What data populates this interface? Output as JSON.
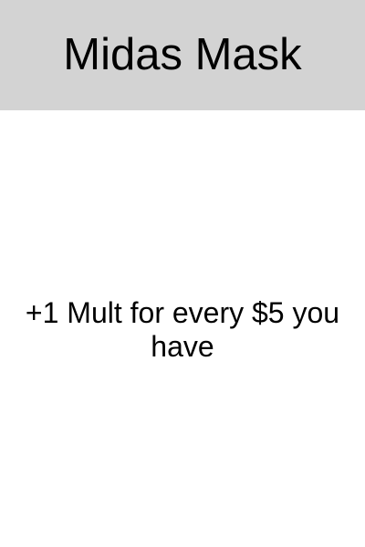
{
  "card": {
    "title": "Midas Mask",
    "description": "+1 Mult for every $5 you have",
    "header_color": "#d3d3d3",
    "background_color": "#ffffff",
    "text_color": "#000000"
  }
}
